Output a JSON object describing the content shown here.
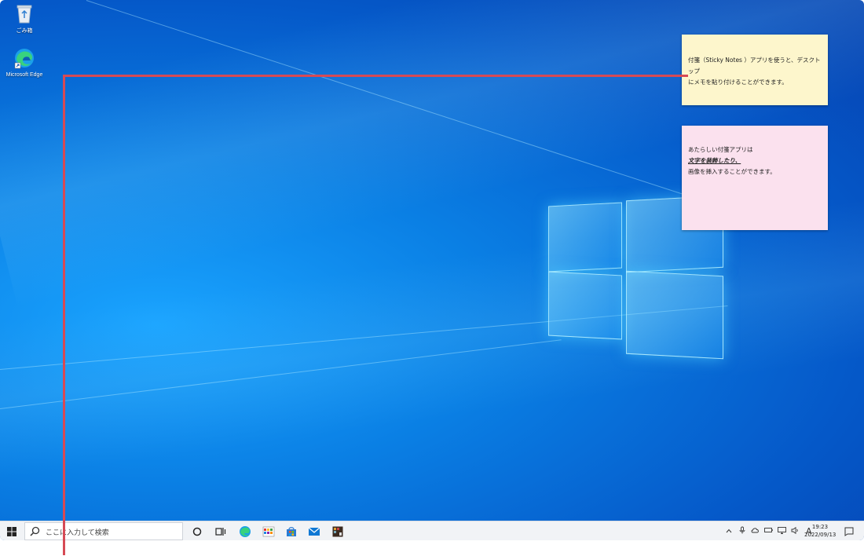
{
  "desktop": {
    "icons": [
      {
        "label": "ごみ箱"
      },
      {
        "label": "Microsoft Edge"
      }
    ]
  },
  "sticky_notes": [
    {
      "color": "#fdf6cc",
      "lines": [
        "付箋（Sticky Notes ）アプリを使うと、デスクトップ",
        "にメモを貼り付けることができます。"
      ]
    },
    {
      "color": "#fbe1ee",
      "line1": "あたらしい付箋アプリは",
      "line2_formatted": "文字を装飾したり、",
      "line3": "画像を挿入することができます。"
    }
  ],
  "taskbar": {
    "search_placeholder": "ここに入力して検索",
    "pinned_apps": [
      "cortana",
      "task-view",
      "edge",
      "paint",
      "store",
      "mail",
      "app"
    ],
    "ime_indicator": "A",
    "clock_time": "19:23",
    "clock_date": "2022/09/13"
  },
  "accent": {
    "pointer": "#d64a55",
    "desktop_blue": "#0a7fe4"
  }
}
